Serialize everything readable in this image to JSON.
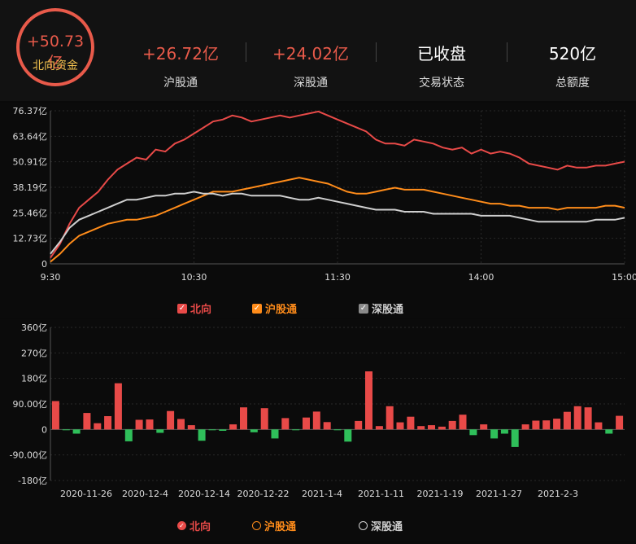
{
  "header": {
    "total": {
      "value": "+50.73亿",
      "label": "北向资金"
    },
    "stats": [
      {
        "value": "+26.72亿",
        "label": "沪股通",
        "color": "#e85a4a"
      },
      {
        "value": "+24.02亿",
        "label": "深股通",
        "color": "#e85a4a"
      },
      {
        "value": "已收盘",
        "label": "交易状态",
        "color": "#ffffff"
      },
      {
        "value": "520亿",
        "label": "总额度",
        "color": "#ffffff"
      }
    ]
  },
  "legend_top": [
    {
      "label": "北向",
      "color": "#e84a48"
    },
    {
      "label": "沪股通",
      "color": "#ff8c1a"
    },
    {
      "label": "深股通",
      "color": "#cfcfcf"
    }
  ],
  "legend_bottom": [
    {
      "label": "北向",
      "color": "#e84a48"
    },
    {
      "label": "沪股通",
      "color": "#ff8c1a"
    },
    {
      "label": "深股通",
      "color": "#cfcfcf"
    }
  ],
  "chart_data": [
    {
      "type": "line",
      "x_ticks": [
        "9:30",
        "10:30",
        "11:30",
        "14:00",
        "15:00"
      ],
      "y_ticks": [
        "76.37亿",
        "63.64亿",
        "50.91亿",
        "38.19亿",
        "25.46亿",
        "12.73亿",
        "0"
      ],
      "ylim": [
        0,
        76.37
      ],
      "series": [
        {
          "name": "北向",
          "color": "#e84a48",
          "values": [
            3,
            10,
            20,
            28,
            32,
            36,
            42,
            47,
            50,
            53,
            52,
            57,
            56,
            60,
            62,
            65,
            68,
            71,
            72,
            74,
            73,
            71,
            72,
            73,
            74,
            73,
            74,
            75,
            76,
            74,
            72,
            70,
            68,
            66,
            62,
            60,
            60,
            59,
            62,
            61,
            60,
            58,
            57,
            58,
            55,
            57,
            55,
            56,
            55,
            53,
            50,
            49,
            48,
            47,
            49,
            48,
            48,
            49,
            49,
            50,
            51
          ]
        },
        {
          "name": "沪股通",
          "color": "#ff8c1a",
          "values": [
            1,
            5,
            10,
            14,
            16,
            18,
            20,
            21,
            22,
            22,
            23,
            24,
            26,
            28,
            30,
            32,
            34,
            36,
            36,
            36,
            37,
            38,
            39,
            40,
            41,
            42,
            43,
            42,
            41,
            40,
            38,
            36,
            35,
            35,
            36,
            37,
            38,
            37,
            37,
            37,
            36,
            35,
            34,
            33,
            32,
            31,
            30,
            30,
            29,
            29,
            28,
            28,
            28,
            27,
            28,
            28,
            28,
            28,
            29,
            29,
            28
          ]
        },
        {
          "name": "深股通",
          "color": "#cfcfcf",
          "values": [
            5,
            11,
            18,
            22,
            24,
            26,
            28,
            30,
            32,
            32,
            33,
            34,
            34,
            35,
            35,
            36,
            35,
            35,
            34,
            35,
            35,
            34,
            34,
            34,
            34,
            33,
            32,
            32,
            33,
            32,
            31,
            30,
            29,
            28,
            27,
            27,
            27,
            26,
            26,
            26,
            25,
            25,
            25,
            25,
            25,
            24,
            24,
            24,
            24,
            23,
            22,
            21,
            21,
            21,
            21,
            21,
            21,
            22,
            22,
            22,
            23
          ]
        }
      ]
    },
    {
      "type": "bar",
      "y_ticks": [
        "360亿",
        "270亿",
        "180亿",
        "90.00亿",
        "0",
        "-90.00亿",
        "-180亿"
      ],
      "ylim": [
        -180,
        360
      ],
      "x_tick_labels": [
        "2020-11-26",
        "2020-12-4",
        "2020-12-14",
        "2020-12-22",
        "2021-1-4",
        "2021-1-11",
        "2021-1-19",
        "2021-1-27",
        "2021-2-3"
      ],
      "values": [
        100,
        -3,
        -15,
        58,
        22,
        47,
        163,
        -42,
        34,
        35,
        -12,
        65,
        37,
        15,
        -40,
        -3,
        -5,
        18,
        78,
        -10,
        75,
        -32,
        40,
        -3,
        42,
        63,
        26,
        -3,
        -43,
        30,
        205,
        12,
        82,
        25,
        45,
        12,
        15,
        10,
        30,
        52,
        -20,
        18,
        -32,
        -15,
        -62,
        18,
        31,
        32,
        38,
        62,
        82,
        78,
        25,
        -15,
        48
      ],
      "pos_color": "#e84a48",
      "neg_color": "#2fbf5a"
    }
  ]
}
